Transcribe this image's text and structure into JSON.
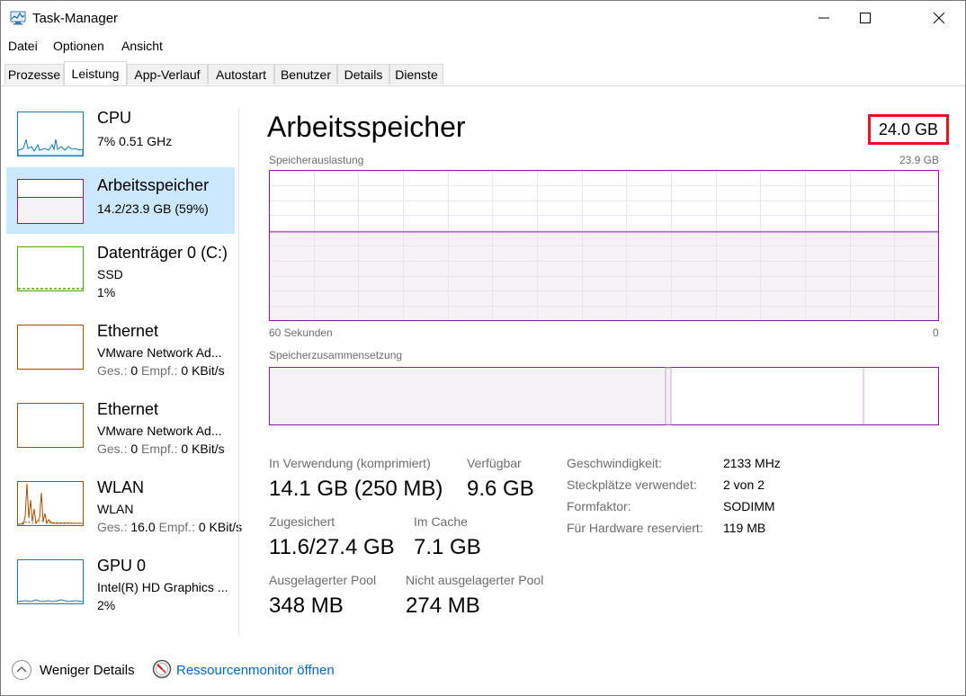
{
  "window": {
    "title": "Task-Manager"
  },
  "menu": [
    "Datei",
    "Optionen",
    "Ansicht"
  ],
  "tabs": [
    "Prozesse",
    "Leistung",
    "App-Verlauf",
    "Autostart",
    "Benutzer",
    "Details",
    "Dienste"
  ],
  "active_tab": "Leistung",
  "sidebar": [
    {
      "title": "CPU",
      "line1": "7%  0.51 GHz",
      "line2": ""
    },
    {
      "title": "Arbeitsspeicher",
      "line1": "14.2/23.9 GB (59%)",
      "line2": ""
    },
    {
      "title": "Datenträger 0 (C:)",
      "line1": "SSD",
      "line2": "1%"
    },
    {
      "title": "Ethernet",
      "line1": "VMware Network Ad...",
      "line2a": "Ges.:",
      "line2b": "0",
      "line2c": "Empf.:",
      "line2d": "0 KBit/s"
    },
    {
      "title": "Ethernet",
      "line1": "VMware Network Ad...",
      "line2a": "Ges.:",
      "line2b": "0",
      "line2c": "Empf.:",
      "line2d": "0 KBit/s"
    },
    {
      "title": "WLAN",
      "line1": "WLAN",
      "line2a": "Ges.:",
      "line2b": "16.0",
      "line2c": "Empf.:",
      "line2d": "0 KBit/s"
    },
    {
      "title": "GPU 0",
      "line1": "Intel(R) HD Graphics ...",
      "line2": "2%"
    }
  ],
  "main": {
    "title": "Arbeitsspeicher",
    "total": "24.0 GB",
    "usage_label": "Speicherauslastung",
    "usage_max": "23.9 GB",
    "time_label": "60 Sekunden",
    "time_end": "0",
    "usage_fraction": 0.59,
    "composition_label": "Speicherzusammensetzung"
  },
  "stats": [
    {
      "label": "In Verwendung (komprimiert)",
      "value": "14.1 GB (250 MB)"
    },
    {
      "label": "Verfügbar",
      "value": "9.6 GB"
    },
    {
      "label": "Zugesichert",
      "value": "11.6/27.4 GB"
    },
    {
      "label": "Im Cache",
      "value": "7.1 GB"
    },
    {
      "label": "Ausgelagerter Pool",
      "value": "348 MB"
    },
    {
      "label": "Nicht ausgelagerter Pool",
      "value": "274 MB"
    }
  ],
  "details": [
    {
      "label": "Geschwindigkeit:",
      "value": "2133 MHz"
    },
    {
      "label": "Steckplätze verwendet:",
      "value": "2 von 2"
    },
    {
      "label": "Formfaktor:",
      "value": "SODIMM"
    },
    {
      "label": "Für Hardware reserviert:",
      "value": "119 MB"
    }
  ],
  "footer": {
    "less_details": "Weniger Details",
    "resource_monitor": "Ressourcenmonitor öffnen"
  },
  "colors": {
    "memory": "#8b12ae",
    "memory_fill": "#f4f2f4",
    "cpu": "#117dbb",
    "disk": "#4da60c",
    "ethernet": "#a74f01",
    "gpu": "#117dbb",
    "selection": "#cce8ff",
    "highlight": "#e81123",
    "link": "#0066cc"
  }
}
